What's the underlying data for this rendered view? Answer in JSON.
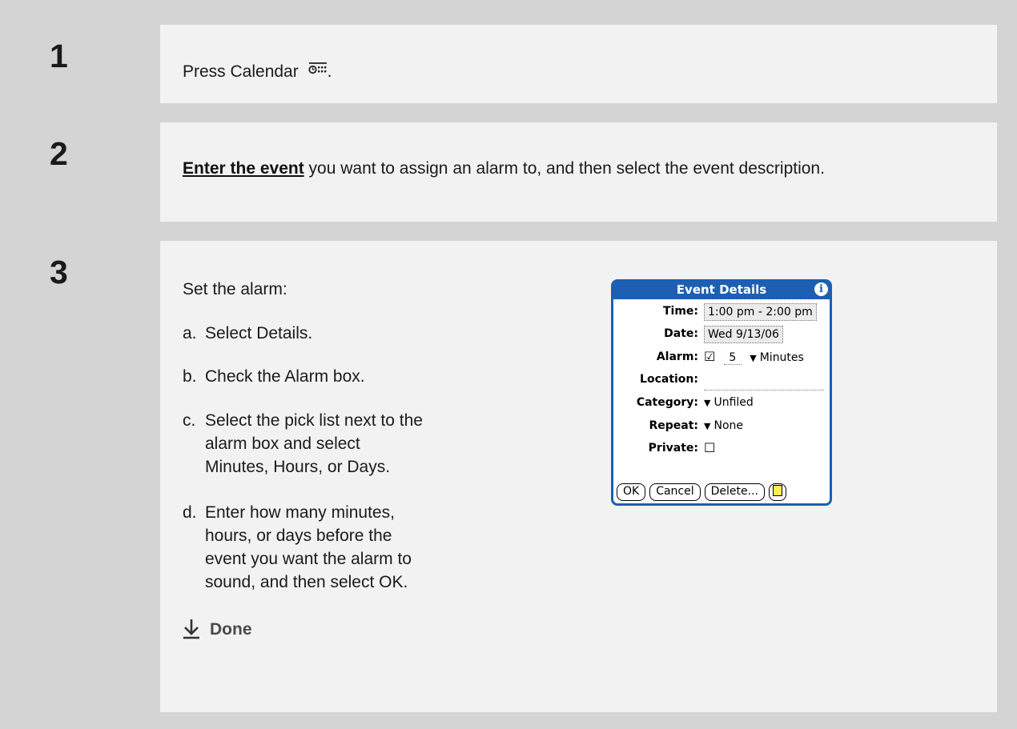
{
  "steps": [
    {
      "number": "1",
      "text_prefix": "Press Calendar ",
      "text_suffix": "."
    },
    {
      "number": "2",
      "link": "Enter the event",
      "text": " you want to assign an alarm to, and then select the event description."
    },
    {
      "number": "3",
      "intro": "Set the alarm:",
      "substeps": [
        {
          "letter": "a.",
          "text": "Select Details."
        },
        {
          "letter": "b.",
          "text": "Check the Alarm box."
        },
        {
          "letter": "c.",
          "text": "Select the pick list next to the alarm box and select Minutes, Hours, or Days."
        },
        {
          "letter": "d.",
          "text": "Enter how many minutes, hours, or days before the event you want the alarm to sound, and then select OK."
        }
      ],
      "done": "Done"
    }
  ],
  "dialog": {
    "title": "Event Details",
    "time_label": "Time:",
    "time_value": "1:00 pm - 2:00 pm",
    "date_label": "Date:",
    "date_value": "Wed 9/13/06",
    "alarm_label": "Alarm:",
    "alarm_checked": true,
    "alarm_amount": "5",
    "alarm_unit": "Minutes",
    "location_label": "Location:",
    "category_label": "Category:",
    "category_value": "Unfiled",
    "repeat_label": "Repeat:",
    "repeat_value": "None",
    "private_label": "Private:",
    "private_checked": false,
    "buttons": {
      "ok": "OK",
      "cancel": "Cancel",
      "delete": "Delete..."
    }
  },
  "colors": {
    "background": "#d4d4d4",
    "panel": "#f2f2f2",
    "dialog_accent": "#1d5fb3"
  }
}
